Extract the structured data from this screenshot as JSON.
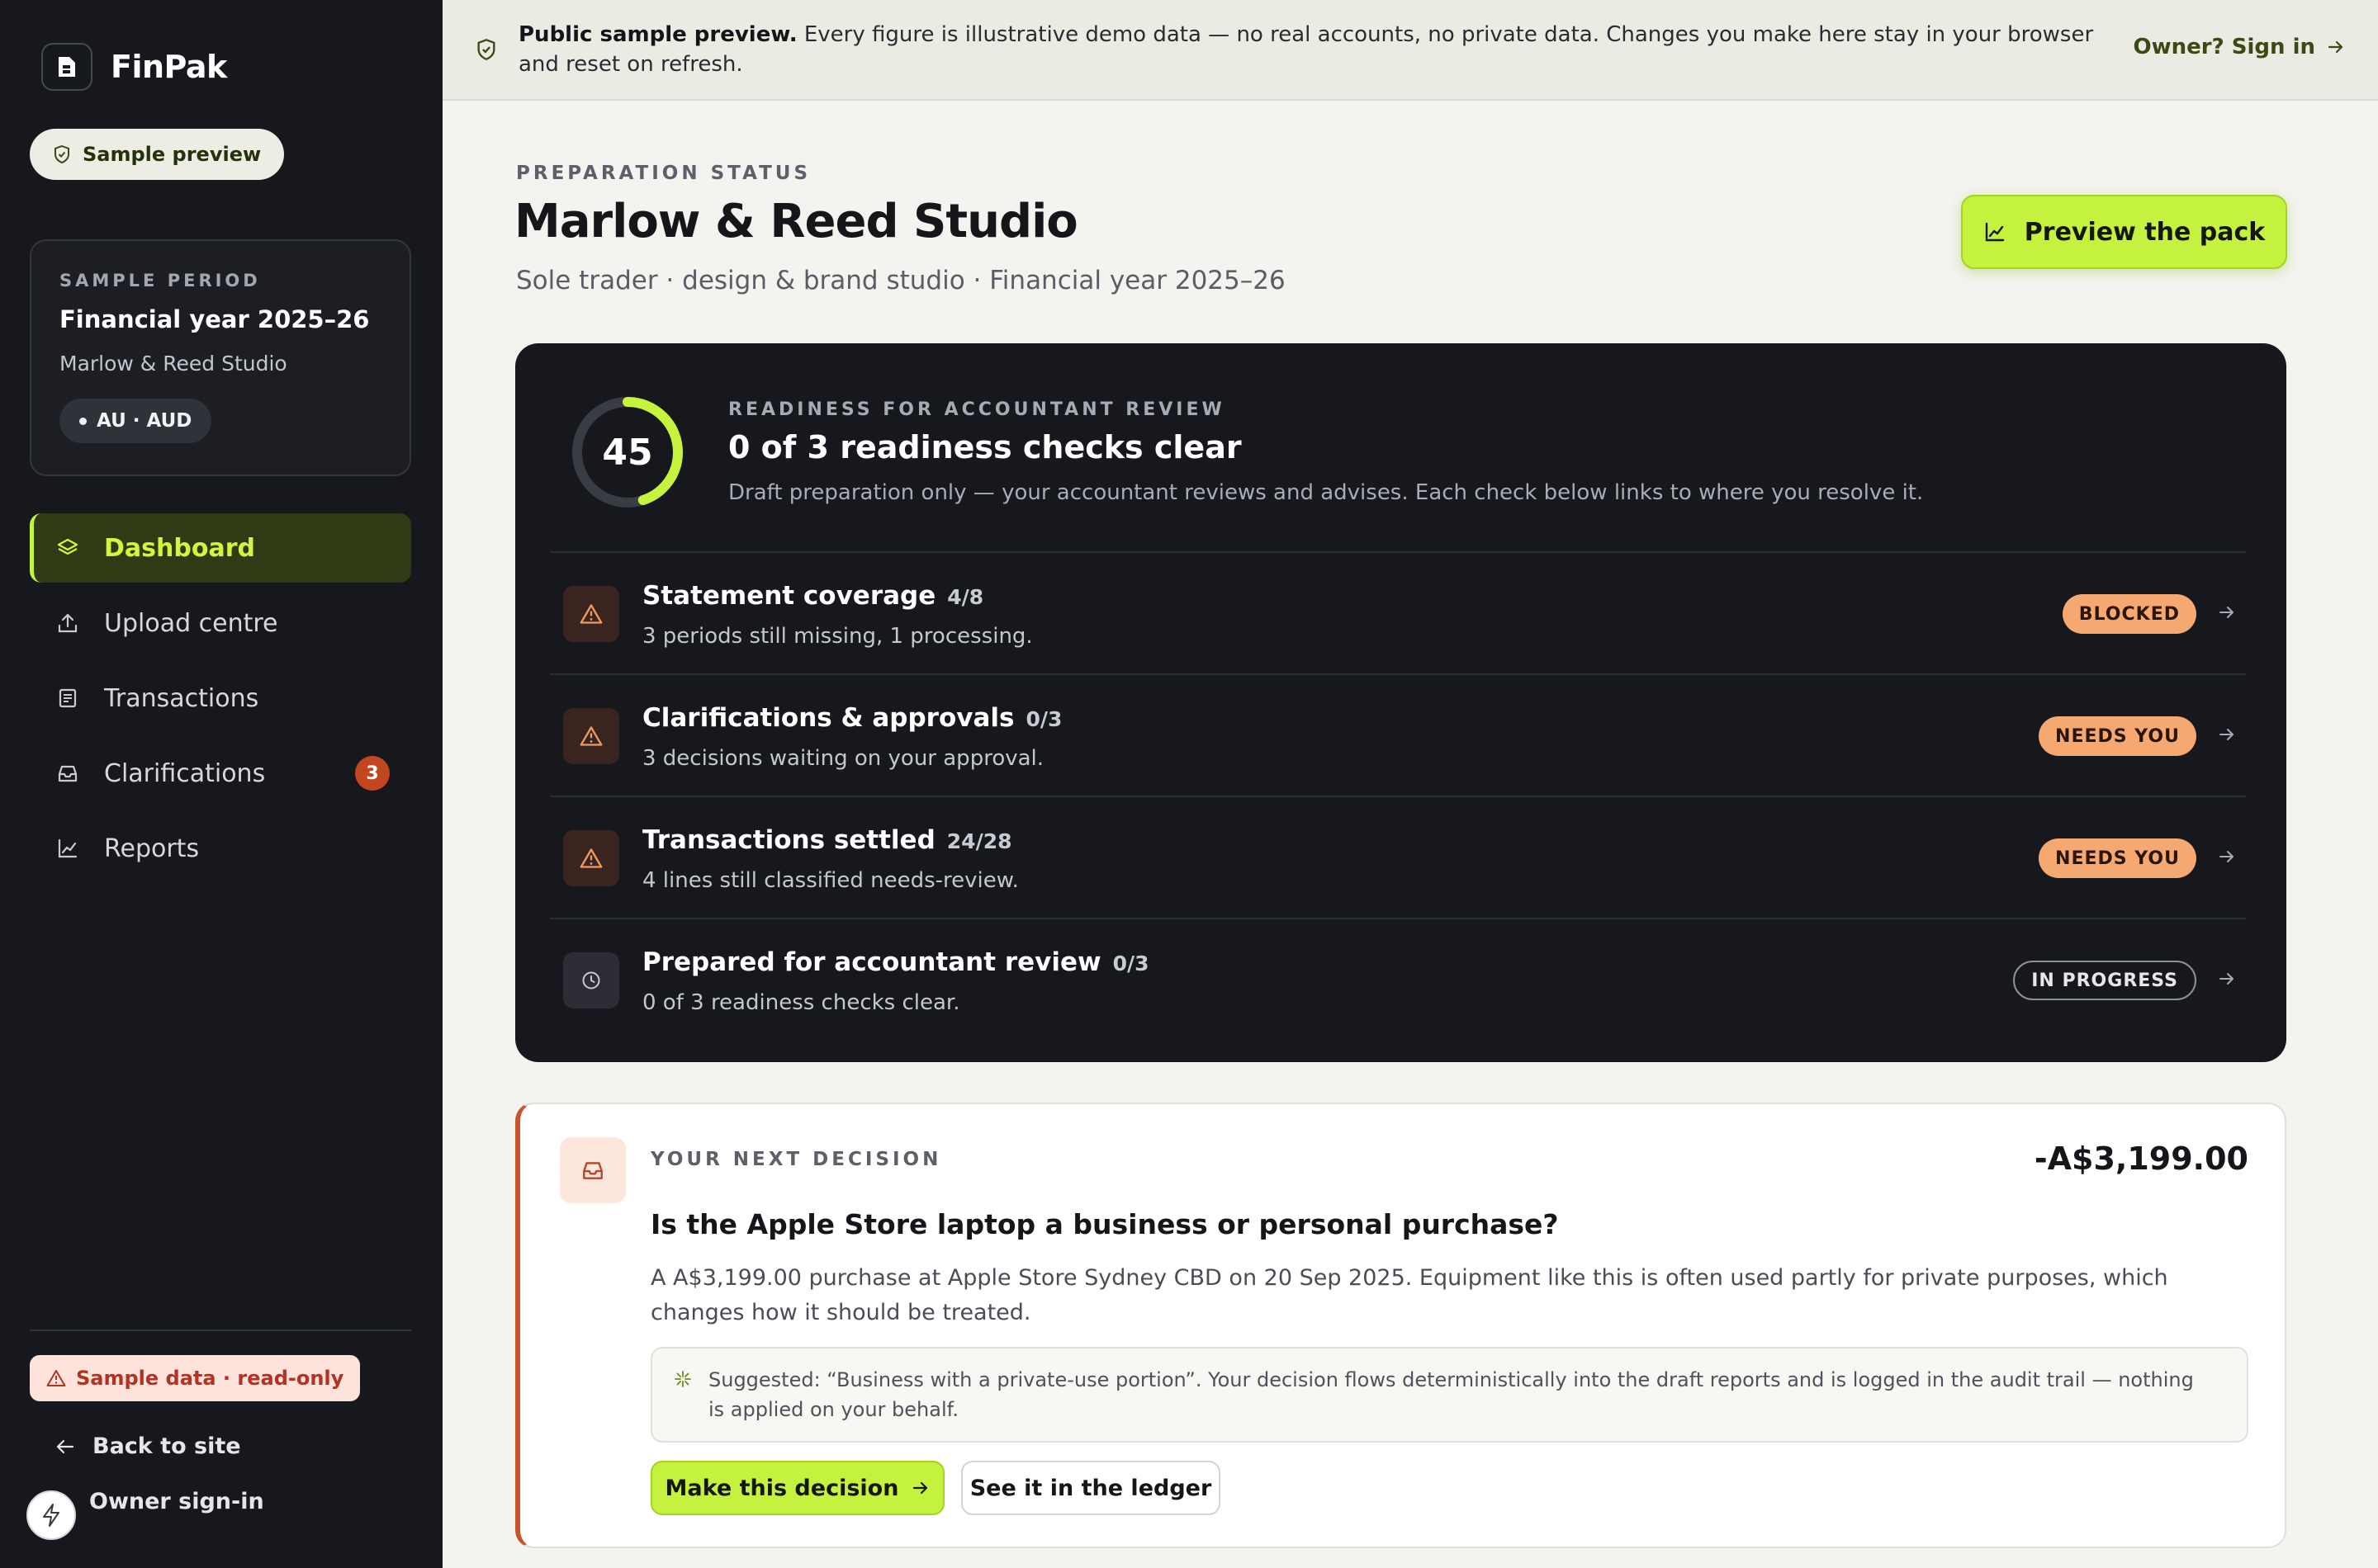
{
  "app": {
    "name": "FinPak"
  },
  "sidebar": {
    "preview_pill": "Sample preview",
    "period": {
      "eyebrow": "SAMPLE PERIOD",
      "title": "Financial year 2025–26",
      "client": "Marlow & Reed Studio",
      "region": "AU · AUD"
    },
    "nav": [
      {
        "label": "Dashboard",
        "icon": "layers-icon",
        "active": true
      },
      {
        "label": "Upload centre",
        "icon": "upload-icon"
      },
      {
        "label": "Transactions",
        "icon": "receipt-icon"
      },
      {
        "label": "Clarifications",
        "icon": "inbox-icon",
        "badge": "3"
      },
      {
        "label": "Reports",
        "icon": "chart-icon"
      }
    ],
    "readonly_pill": "Sample data · read-only",
    "back_link": "Back to site",
    "owner_link": "Owner sign-in"
  },
  "banner": {
    "strong": "Public sample preview.",
    "text": " Every figure is illustrative demo data — no real accounts, no private data. Changes you make here stay in your browser and reset on refresh.",
    "signin": "Owner? Sign in"
  },
  "header": {
    "eyebrow": "PREPARATION STATUS",
    "title": "Marlow & Reed Studio",
    "subtitle": "Sole trader · design & brand studio · Financial year 2025–26",
    "preview_button": "Preview the pack"
  },
  "readiness": {
    "score": "45",
    "score_fraction": 0.45,
    "eyebrow": "READINESS FOR ACCOUNTANT REVIEW",
    "title": "0 of 3 readiness checks clear",
    "subtitle": "Draft preparation only — your accountant reviews and advises. Each check below links to where you resolve it.",
    "checks": [
      {
        "title": "Statement coverage",
        "count": "4/8",
        "desc": "3 periods still missing, 1 processing.",
        "status": "BLOCKED",
        "kind": "warn",
        "icon": "warning-icon"
      },
      {
        "title": "Clarifications & approvals",
        "count": "0/3",
        "desc": "3 decisions waiting on your approval.",
        "status": "NEEDS YOU",
        "kind": "warn",
        "icon": "warning-icon"
      },
      {
        "title": "Transactions settled",
        "count": "24/28",
        "desc": "4 lines still classified needs-review.",
        "status": "NEEDS YOU",
        "kind": "warn",
        "icon": "warning-icon"
      },
      {
        "title": "Prepared for accountant review",
        "count": "0/3",
        "desc": "0 of 3 readiness checks clear.",
        "status": "IN PROGRESS",
        "kind": "progress",
        "icon": "clock-icon"
      }
    ]
  },
  "decision": {
    "eyebrow": "YOUR NEXT DECISION",
    "amount": "-A$3,199.00",
    "question": "Is the Apple Store laptop a business or personal purchase?",
    "body": "A A$3,199.00 purchase at Apple Store Sydney CBD on 20 Sep 2025. Equipment like this is often used partly for private purposes, which changes how it should be treated.",
    "suggestion": "Suggested: “Business with a private-use portion”. Your decision flows deterministically into the draft reports and is logged in the audit trail — nothing is applied on your behalf.",
    "primary_button": "Make this decision",
    "secondary_button": "See it in the ledger"
  },
  "colors": {
    "accent": "#c5f23e",
    "sidebar_bg": "#17181d",
    "warn": "#f5a86f",
    "danger": "#c2461f"
  }
}
